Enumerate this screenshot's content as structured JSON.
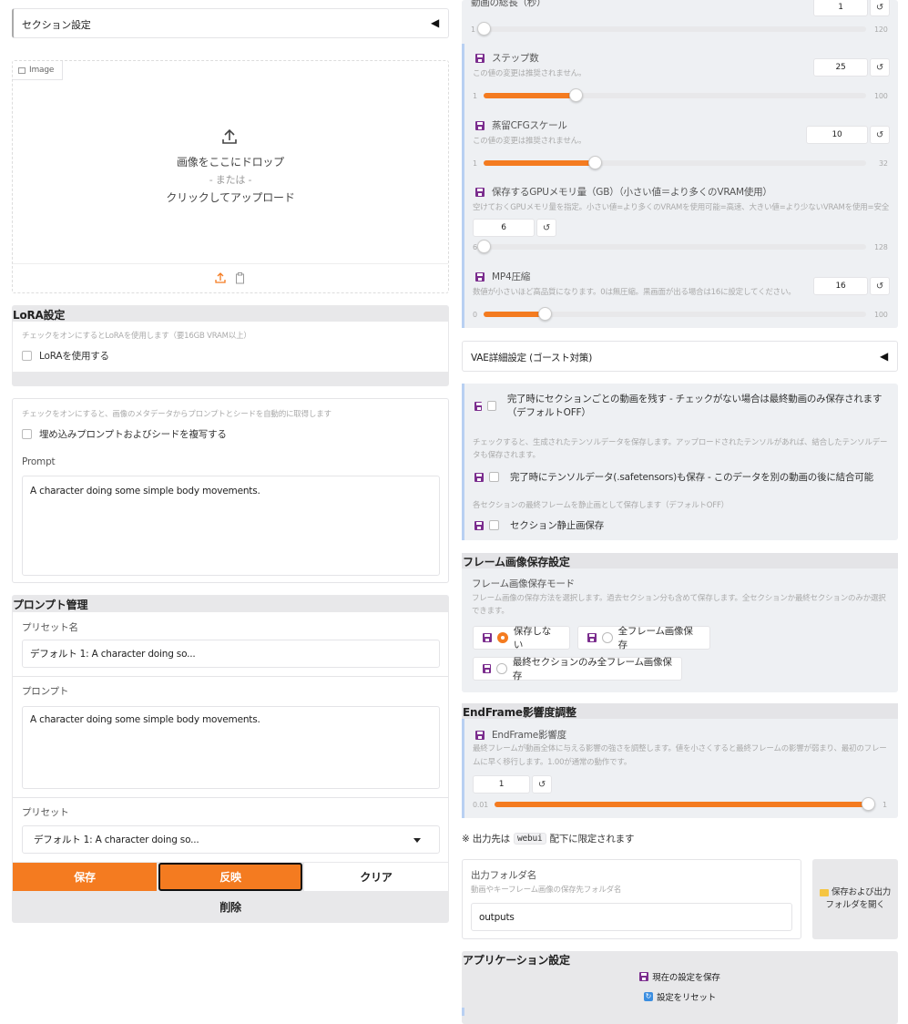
{
  "left": {
    "section_settings": {
      "title": "セクション設定",
      "arrow": "◀"
    },
    "image": {
      "tab_label": "Image",
      "drop_text": "画像をここにドロップ",
      "or_text": "- または -",
      "click_text": "クリックしてアップロード"
    },
    "lora": {
      "title": "LoRA設定",
      "hint": "チェックをオンにするとLoRAを使用します（要16GB VRAM以上）",
      "checkbox_label": "LoRAを使用する"
    },
    "metadata": {
      "hint": "チェックをオンにすると、画像のメタデータからプロンプトとシードを自動的に取得します",
      "checkbox_label": "埋め込みプロンプトおよびシードを複写する"
    },
    "prompt": {
      "label": "Prompt",
      "value": "A character doing some simple body movements."
    },
    "prompt_mgmt": {
      "title": "プロンプト管理",
      "preset_name_label": "プリセット名",
      "preset_name_value": "デフォルト 1: A character doing so...",
      "prompt_label": "プロンプト",
      "prompt_value": "A character doing some simple body movements.",
      "preset_label": "プリセット",
      "preset_value": "デフォルト 1: A character doing so...",
      "save": "保存",
      "apply": "反映",
      "clear": "クリア",
      "delete": "削除"
    }
  },
  "right": {
    "duration": {
      "label": "動画の総長（秒）",
      "value": "1",
      "min": "1",
      "max": "120",
      "fraction": 0.0
    },
    "steps": {
      "label": "ステップ数",
      "hint": "この値の変更は推奨されません。",
      "value": "25",
      "min": "1",
      "max": "100",
      "fraction": 0.24
    },
    "cfg": {
      "label": "蒸留CFGスケール",
      "hint": "この値の変更は推奨されません。",
      "value": "10",
      "min": "1",
      "max": "32",
      "fraction": 0.29
    },
    "gpu": {
      "label": "保存するGPUメモリ量（GB）（小さい値＝より多くのVRAM使用）",
      "hint": "空けておくGPUメモリ量を指定。小さい値=より多くのVRAMを使用可能=高速、大きい値=より少ないVRAMを使用=安全",
      "value": "6",
      "min": "6",
      "max": "128",
      "fraction": 0.0
    },
    "mp4": {
      "label": "MP4圧縮",
      "hint": "数値が小さいほど高品質になります。0は無圧縮。黒画面が出る場合は16に設定してください。",
      "value": "16",
      "min": "0",
      "max": "100",
      "fraction": 0.16
    },
    "vae": {
      "title": "VAE詳細設定 (ゴースト対策)",
      "arrow": "◀"
    },
    "section_video": {
      "label": "完了時にセクションごとの動画を残す - チェックがない場合は最終動画のみ保存されます（デフォルトOFF）"
    },
    "tensor": {
      "hint": "チェックすると、生成されたテンソルデータを保存します。アップロードされたテンソルがあれば、結合したテンソルデータも保存されます。",
      "label": "完了時にテンソルデータ(.safetensors)も保存 - このデータを別の動画の後に結合可能"
    },
    "still": {
      "hint": "各セクションの最終フレームを静止画として保存します（デフォルトOFF）",
      "label": "セクション静止画保存"
    },
    "frame_save": {
      "title": "フレーム画像保存設定",
      "mode_label": "フレーム画像保存モード",
      "hint": "フレーム画像の保存方法を選択します。過去セクション分も含めて保存します。全セクションか最終セクションのみか選択できます。",
      "options": [
        "保存しない",
        "全フレーム画像保存",
        "最終セクションのみ全フレーム画像保存"
      ],
      "selected": "保存しない"
    },
    "endframe": {
      "title": "EndFrame影響度調整",
      "label": "EndFrame影響度",
      "hint": "最終フレームが動画全体に与える影響の強さを調整します。値を小さくすると最終フレームの影響が弱まり、最初のフレームに早く移行します。1.00が通常の動作です。",
      "value": "1",
      "min": "0.01",
      "max": "1",
      "fraction": 1.0
    },
    "output_note": {
      "prefix": "※ 出力先は",
      "code": "webui",
      "suffix": "配下に限定されます"
    },
    "output": {
      "label": "出力フォルダ名",
      "hint": "動画やキーフレーム画像の保存先フォルダ名",
      "value": "outputs",
      "button": "保存および出力フォルダを開く"
    },
    "app": {
      "title": "アプリケーション設定",
      "save": "現在の設定を保存",
      "reset": "設定をリセット"
    }
  },
  "colors": {
    "accent": "#f47b20",
    "save_icon": "#7b2d8e",
    "panel_gray": "#e4e4e7",
    "info_bar": "#b8d0f2"
  }
}
